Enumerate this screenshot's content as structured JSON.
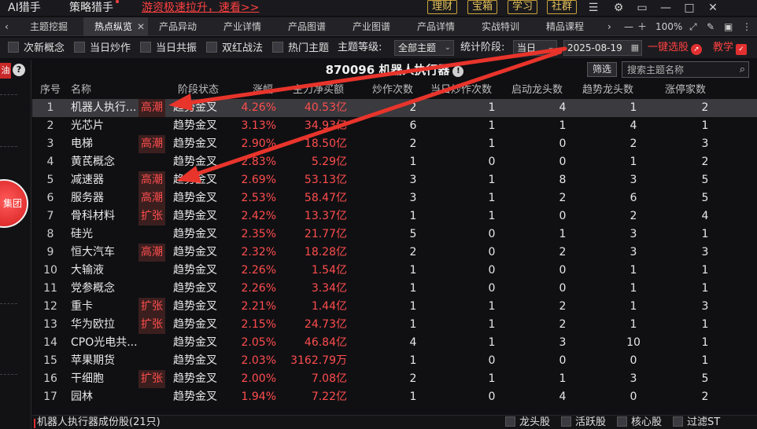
{
  "topbar": {
    "apps": [
      "AI猎手",
      "策略猎手"
    ],
    "promo": "游资极速拉升，速看>>",
    "pills": [
      "理财",
      "宝箱",
      "学习",
      "社群"
    ]
  },
  "tabs": [
    {
      "label": "主题挖掘",
      "active": false
    },
    {
      "label": "热点纵览",
      "active": true
    },
    {
      "label": "产品异动",
      "active": false
    },
    {
      "label": "产业详情",
      "active": false
    },
    {
      "label": "产品图谱",
      "active": false
    },
    {
      "label": "产业图谱",
      "active": false
    },
    {
      "label": "产品详情",
      "active": false
    },
    {
      "label": "实战特训",
      "active": false
    },
    {
      "label": "精品课程",
      "active": false
    }
  ],
  "zoom": "100%",
  "filters": {
    "checkboxes": [
      "次新概念",
      "当日炒作",
      "当日共振",
      "双红战法",
      "热门主题"
    ],
    "level_label": "主题等级:",
    "level_value": "全部主题",
    "stat_label": "统计阶段:",
    "stat_value": "当日",
    "date": "2025-08-19",
    "one_click": "一键选股",
    "teach": "教学"
  },
  "sidebar": {
    "tag": "油",
    "circle_text": "集团"
  },
  "panel": {
    "title": "870096 机器人执行器",
    "filter_button": "筛选",
    "search_placeholder": "搜索主题名称"
  },
  "columns": [
    "序号",
    "名称",
    "阶段状态",
    "涨幅",
    "主力净买额",
    "炒作次数",
    "当日炒作次数",
    "启动龙头数",
    "趋势龙头数",
    "涨停家数"
  ],
  "rows": [
    {
      "idx": "1",
      "name": "机器人执行...",
      "tag": "高潮",
      "stage": "趋势金叉",
      "pct": "4.26%",
      "flow": "40.53亿",
      "n1": "2",
      "n2": "1",
      "n3": "4",
      "n4": "1",
      "n5": "2",
      "selected": true
    },
    {
      "idx": "2",
      "name": "光芯片",
      "tag": "",
      "stage": "趋势金叉",
      "pct": "3.13%",
      "flow": "34.93亿",
      "n1": "6",
      "n2": "1",
      "n3": "1",
      "n4": "4",
      "n5": "1"
    },
    {
      "idx": "3",
      "name": "电梯",
      "tag": "高潮",
      "stage": "趋势金叉",
      "pct": "2.90%",
      "flow": "18.50亿",
      "n1": "2",
      "n2": "1",
      "n3": "0",
      "n4": "2",
      "n5": "3"
    },
    {
      "idx": "4",
      "name": "黄芪概念",
      "tag": "",
      "stage": "趋势金叉",
      "pct": "2.83%",
      "flow": "5.29亿",
      "n1": "1",
      "n2": "0",
      "n3": "0",
      "n4": "1",
      "n5": "2"
    },
    {
      "idx": "5",
      "name": "减速器",
      "tag": "高潮",
      "stage": "趋势金叉",
      "pct": "2.69%",
      "flow": "53.13亿",
      "n1": "3",
      "n2": "1",
      "n3": "8",
      "n4": "3",
      "n5": "5"
    },
    {
      "idx": "6",
      "name": "服务器",
      "tag": "高潮",
      "stage": "趋势金叉",
      "pct": "2.53%",
      "flow": "58.47亿",
      "n1": "3",
      "n2": "1",
      "n3": "2",
      "n4": "6",
      "n5": "5"
    },
    {
      "idx": "7",
      "name": "骨科材料",
      "tag": "扩张",
      "stage": "趋势金叉",
      "pct": "2.42%",
      "flow": "13.37亿",
      "n1": "1",
      "n2": "1",
      "n3": "0",
      "n4": "2",
      "n5": "4"
    },
    {
      "idx": "8",
      "name": "硅光",
      "tag": "",
      "stage": "趋势金叉",
      "pct": "2.35%",
      "flow": "21.77亿",
      "n1": "5",
      "n2": "0",
      "n3": "1",
      "n4": "3",
      "n5": "1"
    },
    {
      "idx": "9",
      "name": "恒大汽车",
      "tag": "高潮",
      "stage": "趋势金叉",
      "pct": "2.32%",
      "flow": "18.28亿",
      "n1": "2",
      "n2": "0",
      "n3": "2",
      "n4": "3",
      "n5": "3"
    },
    {
      "idx": "10",
      "name": "大输液",
      "tag": "",
      "stage": "趋势金叉",
      "pct": "2.26%",
      "flow": "1.54亿",
      "n1": "1",
      "n2": "0",
      "n3": "0",
      "n4": "1",
      "n5": "1"
    },
    {
      "idx": "11",
      "name": "党参概念",
      "tag": "",
      "stage": "趋势金叉",
      "pct": "2.26%",
      "flow": "3.34亿",
      "n1": "1",
      "n2": "0",
      "n3": "0",
      "n4": "1",
      "n5": "1"
    },
    {
      "idx": "12",
      "name": "重卡",
      "tag": "扩张",
      "stage": "趋势金叉",
      "pct": "2.21%",
      "flow": "1.44亿",
      "n1": "1",
      "n2": "1",
      "n3": "2",
      "n4": "1",
      "n5": "3"
    },
    {
      "idx": "13",
      "name": "华为欧拉",
      "tag": "扩张",
      "stage": "趋势金叉",
      "pct": "2.15%",
      "flow": "24.73亿",
      "n1": "1",
      "n2": "1",
      "n3": "2",
      "n4": "1",
      "n5": "1"
    },
    {
      "idx": "14",
      "name": "CPO光电共...",
      "tag": "",
      "stage": "趋势金叉",
      "pct": "2.05%",
      "flow": "46.84亿",
      "n1": "4",
      "n2": "1",
      "n3": "3",
      "n4": "10",
      "n5": "1"
    },
    {
      "idx": "15",
      "name": "苹果期货",
      "tag": "",
      "stage": "趋势金叉",
      "pct": "2.03%",
      "flow": "3162.79万",
      "n1": "1",
      "n2": "0",
      "n3": "0",
      "n4": "0",
      "n5": "1"
    },
    {
      "idx": "16",
      "name": "干细胞",
      "tag": "扩张",
      "stage": "趋势金叉",
      "pct": "2.00%",
      "flow": "7.08亿",
      "n1": "2",
      "n2": "1",
      "n3": "1",
      "n4": "3",
      "n5": "5"
    },
    {
      "idx": "17",
      "name": "园林",
      "tag": "",
      "stage": "趋势金叉",
      "pct": "1.94%",
      "flow": "7.22亿",
      "n1": "1",
      "n2": "0",
      "n3": "4",
      "n4": "0",
      "n5": "2"
    }
  ],
  "footer": {
    "label": "机器人执行器成份股(21只)",
    "checkboxes": [
      "龙头股",
      "活跃股",
      "核心股",
      "过滤ST"
    ]
  },
  "colors": {
    "up_red": "#ff4d4d",
    "accent_gold": "#e7c35a",
    "selected_row": "#3a3a3f"
  }
}
